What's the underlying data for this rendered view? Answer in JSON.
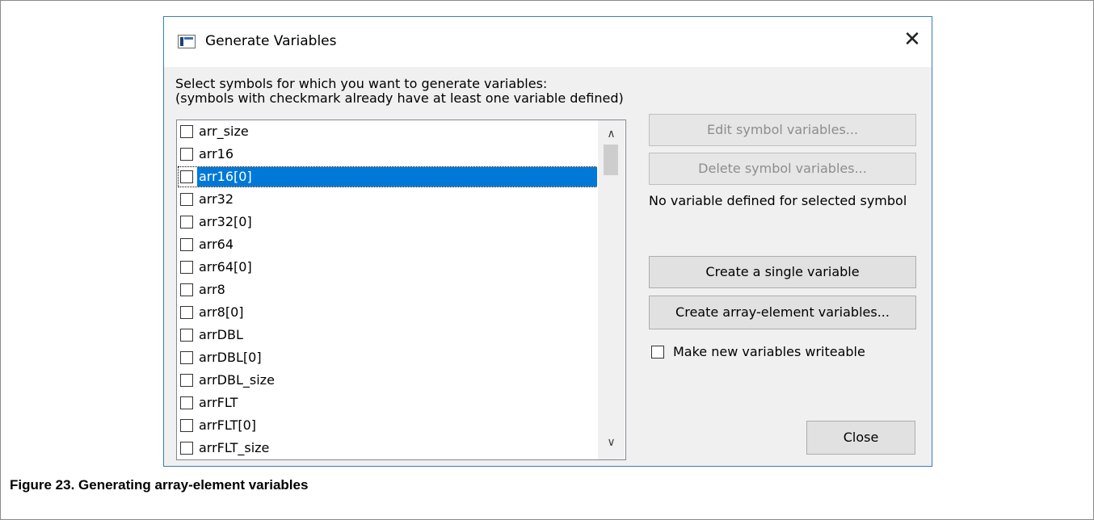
{
  "dialog": {
    "title": "Generate Variables",
    "close_glyph": "✕",
    "instruction_line1": "Select symbols for which you want to generate variables:",
    "instruction_line2": "(symbols with checkmark already have at least one variable defined)"
  },
  "symbols": {
    "items": [
      {
        "label": "arr_size",
        "checked": false,
        "selected": false
      },
      {
        "label": "arr16",
        "checked": false,
        "selected": false
      },
      {
        "label": "arr16[0]",
        "checked": false,
        "selected": true
      },
      {
        "label": "arr32",
        "checked": false,
        "selected": false
      },
      {
        "label": "arr32[0]",
        "checked": false,
        "selected": false
      },
      {
        "label": "arr64",
        "checked": false,
        "selected": false
      },
      {
        "label": "arr64[0]",
        "checked": false,
        "selected": false
      },
      {
        "label": "arr8",
        "checked": false,
        "selected": false
      },
      {
        "label": "arr8[0]",
        "checked": false,
        "selected": false
      },
      {
        "label": "arrDBL",
        "checked": false,
        "selected": false
      },
      {
        "label": "arrDBL[0]",
        "checked": false,
        "selected": false
      },
      {
        "label": "arrDBL_size",
        "checked": false,
        "selected": false
      },
      {
        "label": "arrFLT",
        "checked": false,
        "selected": false
      },
      {
        "label": "arrFLT[0]",
        "checked": false,
        "selected": false
      },
      {
        "label": "arrFLT_size",
        "checked": false,
        "selected": false
      }
    ],
    "scroll_up_glyph": "∧",
    "scroll_down_glyph": "∨"
  },
  "buttons": {
    "edit_symbol_variables": "Edit symbol variables...",
    "delete_symbol_variables": "Delete symbol variables...",
    "create_single_variable": "Create a single variable",
    "create_array_element_variables": "Create array-element variables...",
    "close": "Close"
  },
  "status": "No variable defined for selected symbol",
  "options": {
    "make_writeable_label": "Make new variables writeable",
    "make_writeable_checked": false
  },
  "caption": "Figure 23. Generating array-element variables",
  "colors": {
    "selection": "#0078d7",
    "dialog_border": "#3c7fc1",
    "dialog_bg": "#f0f0f0"
  }
}
